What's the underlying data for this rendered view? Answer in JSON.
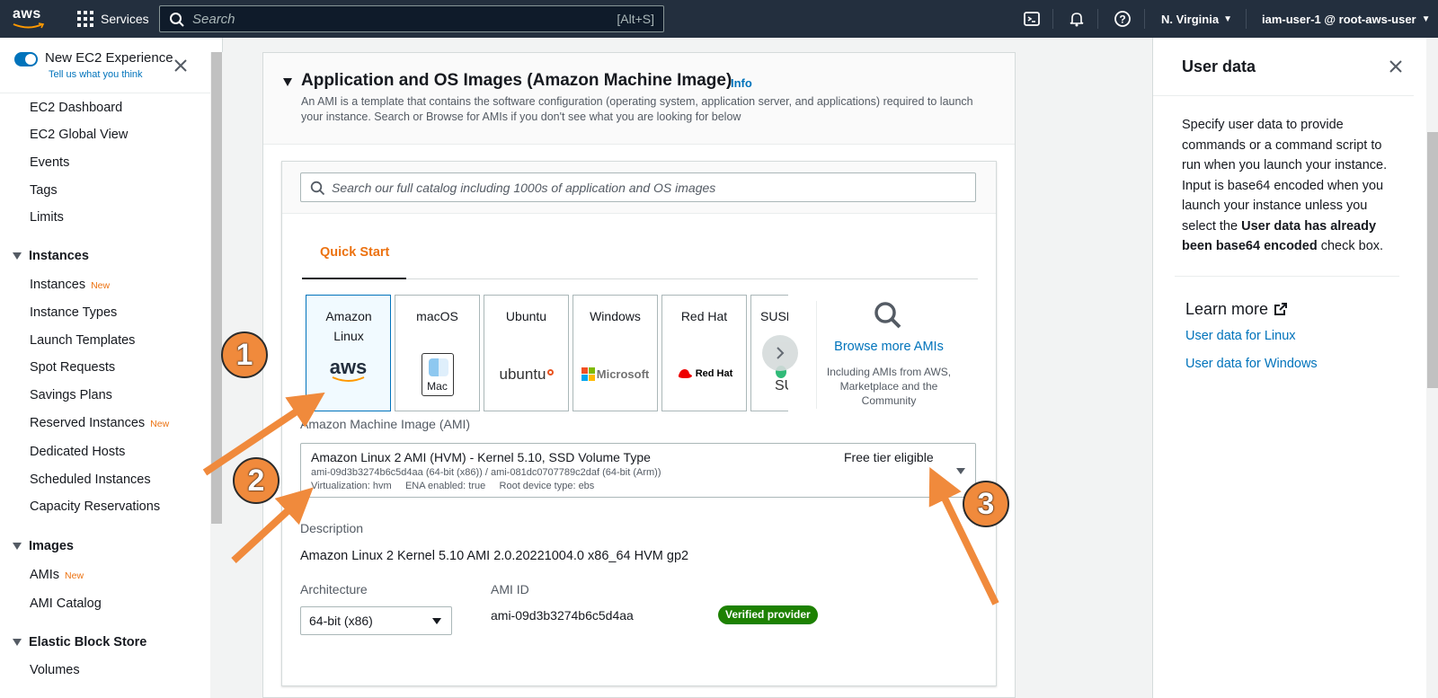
{
  "topnav": {
    "logo_text": "aws",
    "services_label": "Services",
    "search_placeholder": "Search",
    "search_shortcut": "[Alt+S]",
    "region": "N. Virginia",
    "account": "iam-user-1 @ root-aws-user"
  },
  "sidebar": {
    "experience_title": "New EC2 Experience",
    "experience_sub": "Tell us what you think",
    "items": [
      {
        "label": "EC2 Dashboard"
      },
      {
        "label": "EC2 Global View"
      },
      {
        "label": "Events"
      },
      {
        "label": "Tags"
      },
      {
        "label": "Limits"
      }
    ],
    "sections": [
      {
        "title": "Instances",
        "items": [
          {
            "label": "Instances",
            "badge": "New"
          },
          {
            "label": "Instance Types"
          },
          {
            "label": "Launch Templates"
          },
          {
            "label": "Spot Requests"
          },
          {
            "label": "Savings Plans"
          },
          {
            "label": "Reserved Instances",
            "badge": "New"
          },
          {
            "label": "Dedicated Hosts"
          },
          {
            "label": "Scheduled Instances"
          },
          {
            "label": "Capacity Reservations"
          }
        ]
      },
      {
        "title": "Images",
        "items": [
          {
            "label": "AMIs",
            "badge": "New"
          },
          {
            "label": "AMI Catalog"
          }
        ]
      },
      {
        "title": "Elastic Block Store",
        "items": [
          {
            "label": "Volumes"
          }
        ]
      }
    ]
  },
  "main": {
    "title": "Application and OS Images (Amazon Machine Image)",
    "info_link": "Info",
    "description": "An AMI is a template that contains the software configuration (operating system, application server, and applications) required to launch your instance. Search or Browse for AMIs if you don't see what you are looking for below",
    "catalog_search_placeholder": "Search our full catalog including 1000s of application and OS images",
    "tab_quick_start": "Quick Start",
    "tiles": [
      {
        "name": "Amazon Linux",
        "logo_text": "aws"
      },
      {
        "name": "macOS",
        "logo_text": "Mac"
      },
      {
        "name": "Ubuntu",
        "logo_text": "ubuntu"
      },
      {
        "name": "Windows",
        "logo_text": "Microsoft"
      },
      {
        "name": "Red Hat",
        "logo_text": "Red Hat"
      },
      {
        "name": "SUSE",
        "logo_text": "SU"
      }
    ],
    "browse_more": "Browse more AMIs",
    "browse_desc": "Including AMIs from AWS, Marketplace and the Community",
    "ami_label": "Amazon Machine Image (AMI)",
    "ami_name": "Amazon Linux 2 AMI (HVM) - Kernel 5.10, SSD Volume Type",
    "ami_ids": "ami-09d3b3274b6c5d4aa (64-bit (x86)) / ami-081dc0707789c2daf (64-bit (Arm))",
    "ami_meta": "Virtualization: hvm     ENA enabled: true     Root device type: ebs",
    "ami_free": "Free tier eligible",
    "description_label": "Description",
    "description_value": "Amazon Linux 2 Kernel 5.10 AMI 2.0.20221004.0 x86_64 HVM gp2",
    "architecture_label": "Architecture",
    "architecture_value": "64-bit (x86)",
    "ami_id_label": "AMI ID",
    "ami_id_value": "ami-09d3b3274b6c5d4aa",
    "verified_badge": "Verified provider"
  },
  "help_panel": {
    "title": "User data",
    "body_1": "Specify user data to provide commands or a command script to run when you launch your instance. Input is base64 encoded when you launch your instance unless you select the ",
    "body_bold": "User data has already been base64 encoded",
    "body_2": " check box.",
    "learn_more": "Learn more",
    "link_linux": "User data for Linux",
    "link_windows": "User data for Windows"
  },
  "annotations": {
    "badge_1": "1",
    "badge_2": "2",
    "badge_3": "3",
    "color": "#f08a3c"
  },
  "colors": {
    "nav_bg": "#232f3e",
    "accent_orange": "#ec7211",
    "link_blue": "#0073bb",
    "verified_green": "#1d8102"
  }
}
